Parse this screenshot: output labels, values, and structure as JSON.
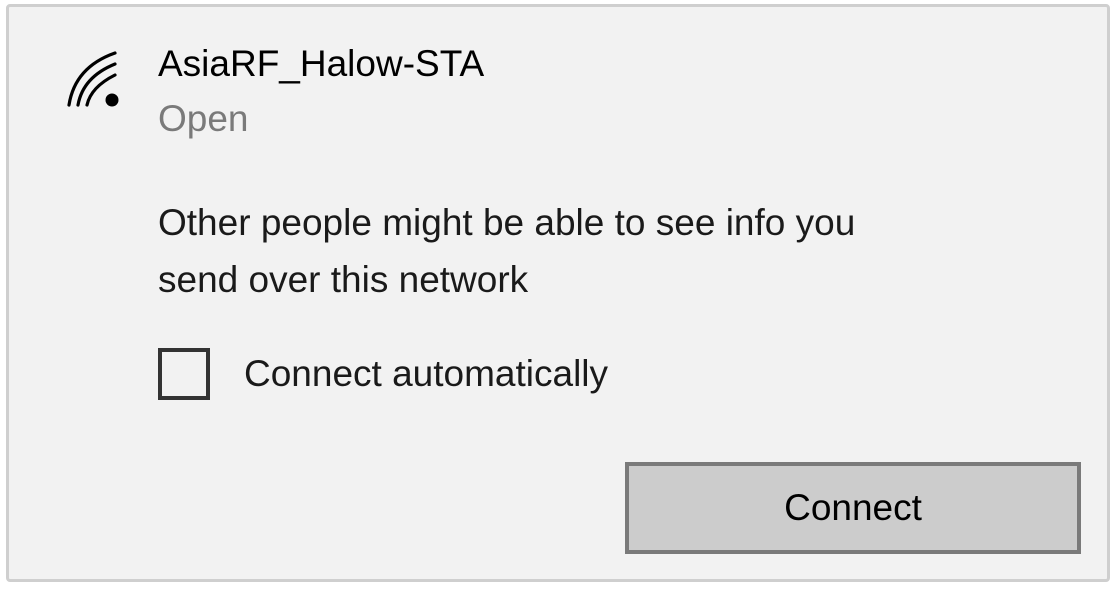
{
  "network": {
    "ssid": "AsiaRF_Halow-STA",
    "security": "Open",
    "icon": "wifi-open-icon"
  },
  "warning": {
    "line1": "Other people might be able to see info you",
    "line2": "send over this network"
  },
  "auto_connect": {
    "label": "Connect automatically",
    "checked": false
  },
  "actions": {
    "connect_label": "Connect"
  },
  "colors": {
    "panel_background": "#f2f2f2",
    "secondary_text": "#7a7a7a",
    "button_background": "#cccccc",
    "button_border": "#7a7a7a"
  }
}
